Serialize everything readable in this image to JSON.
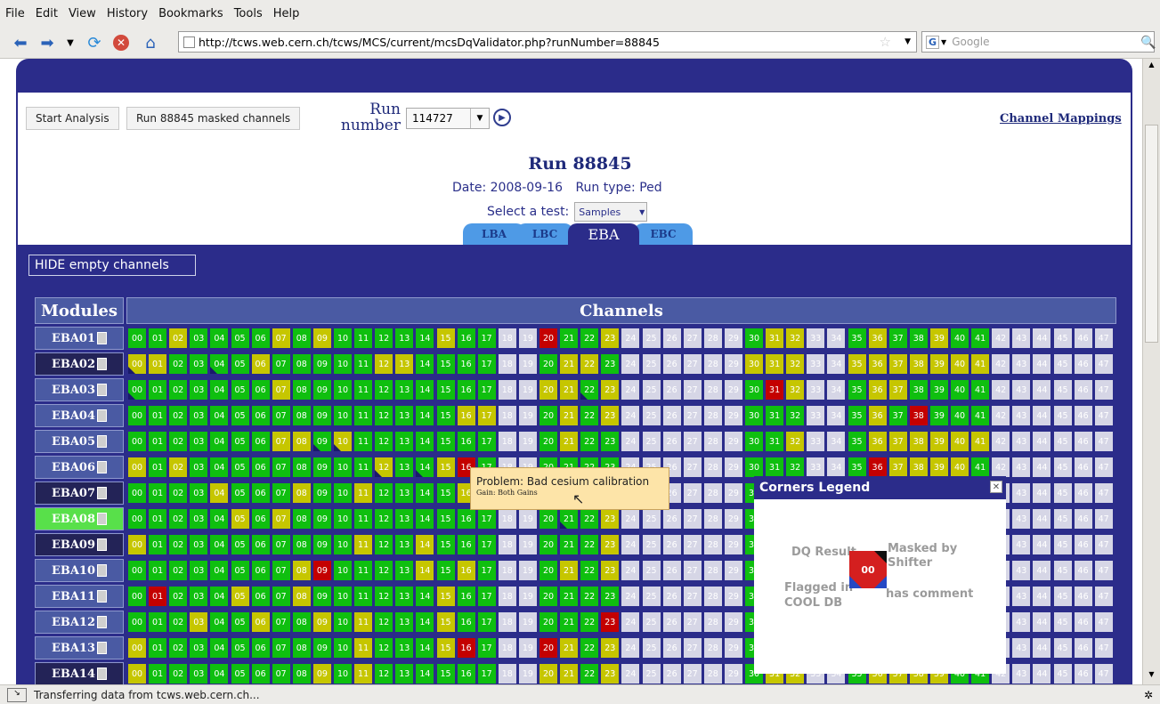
{
  "browser": {
    "menu": [
      "File",
      "Edit",
      "View",
      "History",
      "Bookmarks",
      "Tools",
      "Help"
    ],
    "url": "http://tcws.web.cern.ch/tcws/MCS/current/mcsDqValidator.php?runNumber=88845",
    "search_placeholder": "Google",
    "status": "Transferring data from tcws.web.cern.ch..."
  },
  "controls": {
    "start_analysis": "Start Analysis",
    "masked_channels": "Run 88845 masked channels",
    "run_number_label_1": "Run",
    "run_number_label_2": "number",
    "run_select_value": "114727",
    "channel_mappings": "Channel Mappings"
  },
  "run": {
    "title": "Run 88845",
    "date_label": "Date: 2008-09-16",
    "type_label": "Run type: Ped",
    "select_test_label": "Select a test:",
    "test_value": "Samples"
  },
  "tabs": [
    {
      "label": "LBA",
      "active": false
    },
    {
      "label": "LBC",
      "active": false
    },
    {
      "label": "EBA",
      "active": true
    },
    {
      "label": "EBC",
      "active": false
    }
  ],
  "hide_empty": "HIDE empty channels",
  "table": {
    "modules_header": "Modules",
    "channels_header": "Channels",
    "channel_numbers": [
      "00",
      "01",
      "02",
      "03",
      "04",
      "05",
      "06",
      "07",
      "08",
      "09",
      "10",
      "11",
      "12",
      "13",
      "14",
      "15",
      "16",
      "17",
      "18",
      "19",
      "20",
      "21",
      "22",
      "23",
      "24",
      "25",
      "26",
      "27",
      "28",
      "29",
      "30",
      "31",
      "32",
      "33",
      "34",
      "35",
      "36",
      "37",
      "38",
      "39",
      "40",
      "41",
      "42",
      "43",
      "44",
      "45",
      "46",
      "47"
    ],
    "empty_channels": [
      18,
      19,
      24,
      25,
      26,
      27,
      28,
      29,
      33,
      34,
      42,
      43,
      44,
      45,
      46,
      47
    ],
    "rows": [
      {
        "module": "EBA01",
        "module_style": "normal",
        "yellow": [
          2,
          7,
          9,
          15,
          23,
          31,
          32,
          36,
          39
        ],
        "red": [
          20
        ],
        "corners": []
      },
      {
        "module": "EBA02",
        "module_style": "dark",
        "yellow": [
          0,
          1,
          6,
          12,
          13,
          21,
          22,
          30,
          31,
          32,
          35,
          36,
          37,
          38,
          39,
          40,
          41
        ],
        "red": [],
        "corners": [
          0,
          4
        ]
      },
      {
        "module": "EBA03",
        "module_style": "normal",
        "yellow": [
          7,
          20,
          21,
          23,
          32,
          36,
          37
        ],
        "red": [
          31
        ],
        "corners": [
          0,
          22
        ]
      },
      {
        "module": "EBA04",
        "module_style": "normal",
        "yellow": [
          16,
          17,
          21,
          23,
          36
        ],
        "red": [
          38
        ],
        "corners": []
      },
      {
        "module": "EBA05",
        "module_style": "normal",
        "yellow": [
          7,
          8,
          10,
          21,
          32,
          36,
          37,
          38,
          39,
          40,
          41
        ],
        "red": [],
        "corners": [
          9,
          10
        ]
      },
      {
        "module": "EBA06",
        "module_style": "normal",
        "yellow": [
          0,
          2,
          12,
          15,
          37,
          38,
          39,
          40
        ],
        "red": [
          16,
          36
        ],
        "corners": [
          12,
          14
        ]
      },
      {
        "module": "EBA07",
        "module_style": "dark",
        "yellow": [
          4,
          8,
          11,
          16
        ],
        "red": [],
        "corners": []
      },
      {
        "module": "EBA08",
        "module_style": "highlight",
        "yellow": [
          5,
          7,
          23
        ],
        "red": [],
        "corners": [
          21
        ]
      },
      {
        "module": "EBA09",
        "module_style": "dark",
        "yellow": [
          0,
          11,
          14,
          23
        ],
        "red": [],
        "corners": []
      },
      {
        "module": "EBA10",
        "module_style": "normal",
        "yellow": [
          8,
          14,
          16,
          21,
          23
        ],
        "red": [
          9
        ],
        "corners": []
      },
      {
        "module": "EBA11",
        "module_style": "normal",
        "yellow": [
          5,
          8,
          15
        ],
        "red": [
          1
        ],
        "corners": []
      },
      {
        "module": "EBA12",
        "module_style": "normal",
        "yellow": [
          3,
          6,
          9,
          11,
          15
        ],
        "red": [
          23
        ],
        "corners": []
      },
      {
        "module": "EBA13",
        "module_style": "normal",
        "yellow": [
          0,
          11,
          15,
          21,
          23
        ],
        "red": [
          16,
          20
        ],
        "corners": []
      },
      {
        "module": "EBA14",
        "module_style": "dark",
        "yellow": [
          0,
          9,
          11,
          20,
          21,
          23,
          31,
          32,
          36,
          37,
          38,
          39
        ],
        "red": [],
        "corners": []
      }
    ]
  },
  "tooltip": {
    "problem": "Problem: Bad cesium calibration",
    "gain": "Gain: Both Gains"
  },
  "legend": {
    "title": "Corners Legend",
    "dq_result": "DQ Result",
    "masked_by": "Masked by",
    "shifter": "Shifter",
    "flagged_in": "Flagged in",
    "cool_db": "COOL DB",
    "has_comment": "has comment",
    "sample_value": "00"
  },
  "colors": {
    "green": "#0fbf0f",
    "yellow": "#c6c600",
    "red": "#c40000",
    "empty": "#d6d6e6",
    "navy": "#2b2c8a",
    "module_normal": "#4a5aa3",
    "module_dark": "#232357",
    "module_highlight": "#58e04a"
  }
}
